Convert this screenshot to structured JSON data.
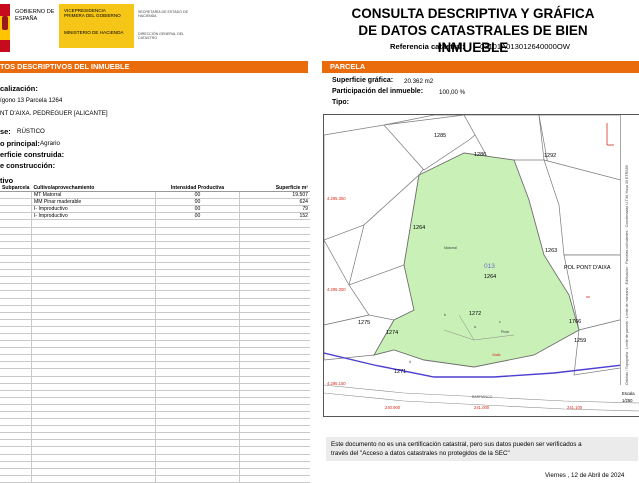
{
  "header": {
    "gobierno": "GOBIERNO DE ESPAÑA",
    "vicepresidencia": "VICEPRESIDENCIA PRIMERA DEL GOBIERNO",
    "ministerio": "MINISTERIO DE HACIENDA",
    "secretaria": "SECRETARÍA DE ESTADO DE HACIENDA",
    "direccion": "DIRECCIÓN GENERAL DEL CATASTRO",
    "title_line1": "CONSULTA DESCRIPTIVA Y GRÁFICA",
    "title_line2": "DE DATOS CATASTRALES DE BIEN INMUEBLE",
    "ref_label": "Referencia catastral:",
    "ref_value": "03101A013012640000OW"
  },
  "left": {
    "bar_prefix": "TOS DESCRIPTIVOS DEL ",
    "bar_strong": "INMUEBLE",
    "localizacion_label": "calización:",
    "localizacion_line1": "ígono 13 Parcela 1264",
    "localizacion_line2": "NT D'AIXA. PEDREGUER [ALICANTE]",
    "clase_label": "se:",
    "clase_value": "RÚSTICO",
    "uso_label": "o principal:",
    "uso_value": "Agrario",
    "superficie_label": "erficie construida:",
    "construccion_label": "e construcción:",
    "cultivo_label": "tivo",
    "table_headers": [
      "Subparcela",
      "Cultivo/aprovechamiento",
      "Intensidad Productiva",
      "Superficie m²"
    ],
    "rows": [
      {
        "sub": "",
        "cultivo": "MT Matorral",
        "intensidad": "00",
        "superficie": "19.507"
      },
      {
        "sub": "",
        "cultivo": "MM Pinar maderable",
        "intensidad": "00",
        "superficie": "624"
      },
      {
        "sub": "",
        "cultivo": "I- Improductivo",
        "intensidad": "00",
        "superficie": "79"
      },
      {
        "sub": "",
        "cultivo": "I- Improductivo",
        "intensidad": "00",
        "superficie": "152"
      }
    ],
    "empty_row_labels": [
      "",
      "",
      "",
      "",
      "",
      "",
      "",
      "",
      "",
      "",
      "",
      "",
      "",
      "",
      "",
      "",
      "",
      "",
      "",
      "",
      "",
      "",
      "",
      "",
      "",
      "",
      "",
      "",
      "",
      "",
      "",
      "",
      "",
      "",
      "",
      "",
      ""
    ]
  },
  "right": {
    "bar_label": "PARCELA",
    "superficie_label": "Superficie gráfica:",
    "superficie_value": "20.362 m2",
    "participacion_label": "Participación del inmueble:",
    "participacion_value": "100,00 %",
    "tipo_label": "Tipo:"
  },
  "map": {
    "parcel_labels": {
      "p1285": "1285",
      "p1286": "1286",
      "p1292": "1292",
      "p1264a": "1264",
      "p1263": "1263",
      "p1275": "1275",
      "p1274": "1274",
      "p1271": "1271",
      "p1272": "1272",
      "p1766": "1766",
      "p1259": "1259",
      "p013": "013",
      "p1264b": "1264",
      "pont": "POL PONT D'AIXA"
    },
    "subparcel_labels": {
      "s1": "b",
      "s2": "a",
      "s3": "c",
      "s4": "d"
    },
    "small_labels": {
      "matorral": "Matorral",
      "pinar": "Pinar",
      "vialla": "Vialla",
      "barranco": "BARRANCO"
    },
    "y_coords": [
      "4.295.350",
      "4.295.300",
      "4.295.150"
    ],
    "x_coords": [
      "240.900",
      "241.000",
      "241.100"
    ],
    "side_labels": [
      "Ortofoto / Topografía",
      "Límite de parcela",
      "Límite de manzana",
      "Edificación",
      "Parcelas colindantes",
      "Coordenadas U.T.M. Huso 30 ETRS89"
    ],
    "scale_label": "Escala",
    "scale_value": "1/250"
  },
  "footer": {
    "note_line1": "Este documento no es una certificación catastral, pero sus datos pueden ser verificados a",
    "note_line2": "través del \"Acceso a datos catastrales no protegidos de la SEC\"",
    "date": "Viernes , 12 de Abril de 2024"
  },
  "colors": {
    "orange": "#e96b0c",
    "parcel_fill": "#c9f0b6",
    "parcel_stroke": "#6f6f6f",
    "river": "#4a3fd0",
    "coord_red": "#d62a1e",
    "yellow": "#f5c518"
  }
}
